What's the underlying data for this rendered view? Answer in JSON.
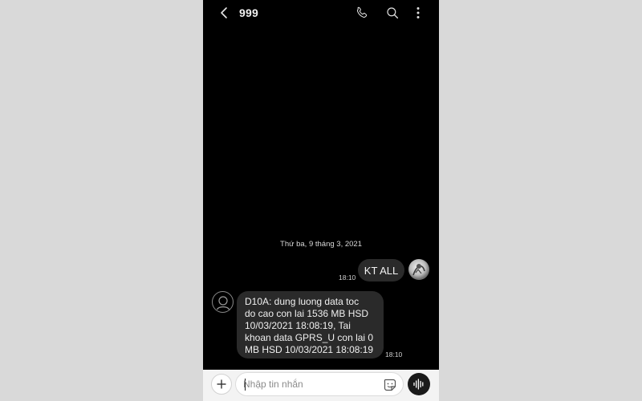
{
  "header": {
    "title": "999",
    "icons": {
      "back": "back-arrow-icon",
      "call": "phone-icon",
      "search": "search-icon",
      "more": "more-vertical-icon"
    }
  },
  "conversation": {
    "date_separator": "Thứ ba, 9 tháng 3, 2021",
    "messages": [
      {
        "direction": "outgoing",
        "text": "KT ALL",
        "time": "18:10"
      },
      {
        "direction": "incoming",
        "text": "D10A: dung luong data toc\ndo cao con lai 1536 MB HSD\n10/03/2021 18:08:19, Tai\nkhoan data GPRS_U con lai 0\nMB HSD 10/03/2021 18:08:19",
        "time": "18:10"
      }
    ]
  },
  "composer": {
    "placeholder": "Nhập tin nhắn",
    "value": "",
    "icons": {
      "add": "plus-icon",
      "sticker": "sticker-icon",
      "voice": "voice-wave-icon"
    }
  },
  "colors": {
    "background": "#000000",
    "bubble": "#2a2a2a",
    "composer_bar": "#f3f3f3",
    "outer": "#d9d9d9"
  }
}
